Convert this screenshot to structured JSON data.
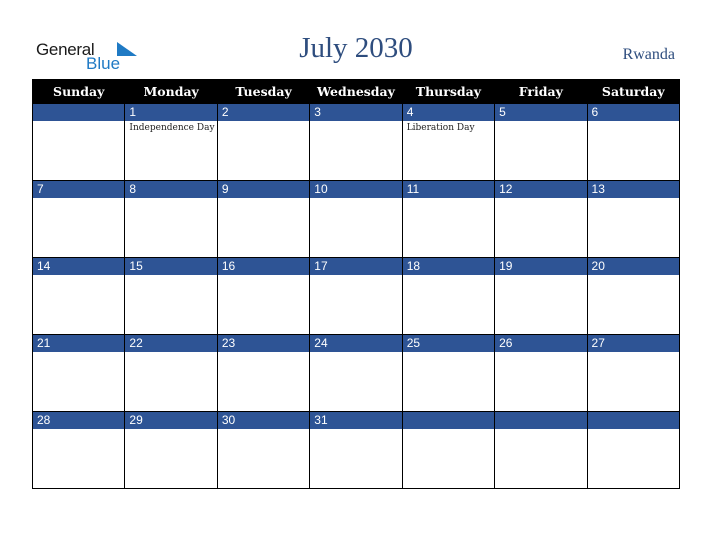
{
  "logo": {
    "line1": "General",
    "line2": "Blue"
  },
  "title": "July 2030",
  "country": "Rwanda",
  "weekdays": [
    "Sunday",
    "Monday",
    "Tuesday",
    "Wednesday",
    "Thursday",
    "Friday",
    "Saturday"
  ],
  "weeks": [
    [
      {
        "day": "",
        "event": ""
      },
      {
        "day": "1",
        "event": "Independence Day"
      },
      {
        "day": "2",
        "event": ""
      },
      {
        "day": "3",
        "event": ""
      },
      {
        "day": "4",
        "event": "Liberation Day"
      },
      {
        "day": "5",
        "event": ""
      },
      {
        "day": "6",
        "event": ""
      }
    ],
    [
      {
        "day": "7",
        "event": ""
      },
      {
        "day": "8",
        "event": ""
      },
      {
        "day": "9",
        "event": ""
      },
      {
        "day": "10",
        "event": ""
      },
      {
        "day": "11",
        "event": ""
      },
      {
        "day": "12",
        "event": ""
      },
      {
        "day": "13",
        "event": ""
      }
    ],
    [
      {
        "day": "14",
        "event": ""
      },
      {
        "day": "15",
        "event": ""
      },
      {
        "day": "16",
        "event": ""
      },
      {
        "day": "17",
        "event": ""
      },
      {
        "day": "18",
        "event": ""
      },
      {
        "day": "19",
        "event": ""
      },
      {
        "day": "20",
        "event": ""
      }
    ],
    [
      {
        "day": "21",
        "event": ""
      },
      {
        "day": "22",
        "event": ""
      },
      {
        "day": "23",
        "event": ""
      },
      {
        "day": "24",
        "event": ""
      },
      {
        "day": "25",
        "event": ""
      },
      {
        "day": "26",
        "event": ""
      },
      {
        "day": "27",
        "event": ""
      }
    ],
    [
      {
        "day": "28",
        "event": ""
      },
      {
        "day": "29",
        "event": ""
      },
      {
        "day": "30",
        "event": ""
      },
      {
        "day": "31",
        "event": ""
      },
      {
        "day": "",
        "event": ""
      },
      {
        "day": "",
        "event": ""
      },
      {
        "day": "",
        "event": ""
      }
    ]
  ],
  "colors": {
    "header_bg": "#000000",
    "daynum_bg": "#2e5495",
    "title": "#2e4d7e",
    "logo_blue": "#1f7ac4"
  }
}
